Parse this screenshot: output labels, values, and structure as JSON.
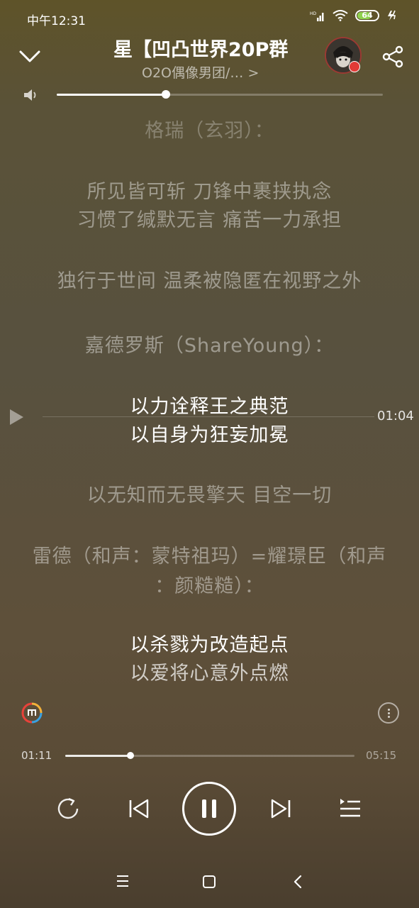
{
  "status_bar": {
    "time": "中午12:31",
    "battery": "64"
  },
  "player": {
    "title": "星【凹凸世界20P群",
    "artist": "O2O偶像男团/… >",
    "current_time": "01:11",
    "total_time": "05:15",
    "progress_percent": 22.5,
    "volume_percent": 33
  },
  "lyrics": {
    "lines": [
      {
        "text": "格瑞（玄羽）：",
        "style": "faint"
      },
      {
        "text": "所见皆可斩 刀锋中裹挟执念",
        "style": "dim"
      },
      {
        "text": "习惯了缄默无言 痛苦一力承担",
        "style": "dim"
      },
      {
        "text": "独行于世间 温柔被隐匿在视野之外",
        "style": "dim"
      },
      {
        "text": "嘉德罗斯（ShareYoung）：",
        "style": "dim"
      },
      {
        "text": "以力诠释王之典范",
        "style": "bright"
      },
      {
        "text": "以自身为狂妄加冕",
        "style": "bright"
      },
      {
        "text": "以无知而无畏擎天 目空一切",
        "style": "dim"
      },
      {
        "text": "雷德（和声：蒙特祖玛）=耀璟臣（和声",
        "style": "dim"
      },
      {
        "text": "：颜糙糙）：",
        "style": "dim"
      },
      {
        "text": "以杀戮为改造起点",
        "style": "bright"
      },
      {
        "text": "以爱将心意外点燃",
        "style": "dim"
      }
    ],
    "seek_time": "01:04"
  },
  "icons": {
    "collapse": "chevron-down-icon",
    "share": "share-icon",
    "volume": "volume-icon",
    "brand": "music-app-logo-icon",
    "more": "more-vertical-icon",
    "repeat": "repeat-icon",
    "prev": "skip-previous-icon",
    "play": "pause-icon",
    "next": "skip-next-icon",
    "playlist": "playlist-icon"
  },
  "colors": {
    "battery": "#8fd14f",
    "avatar_ring": "#9a3a33",
    "badge": "#e23a36"
  }
}
